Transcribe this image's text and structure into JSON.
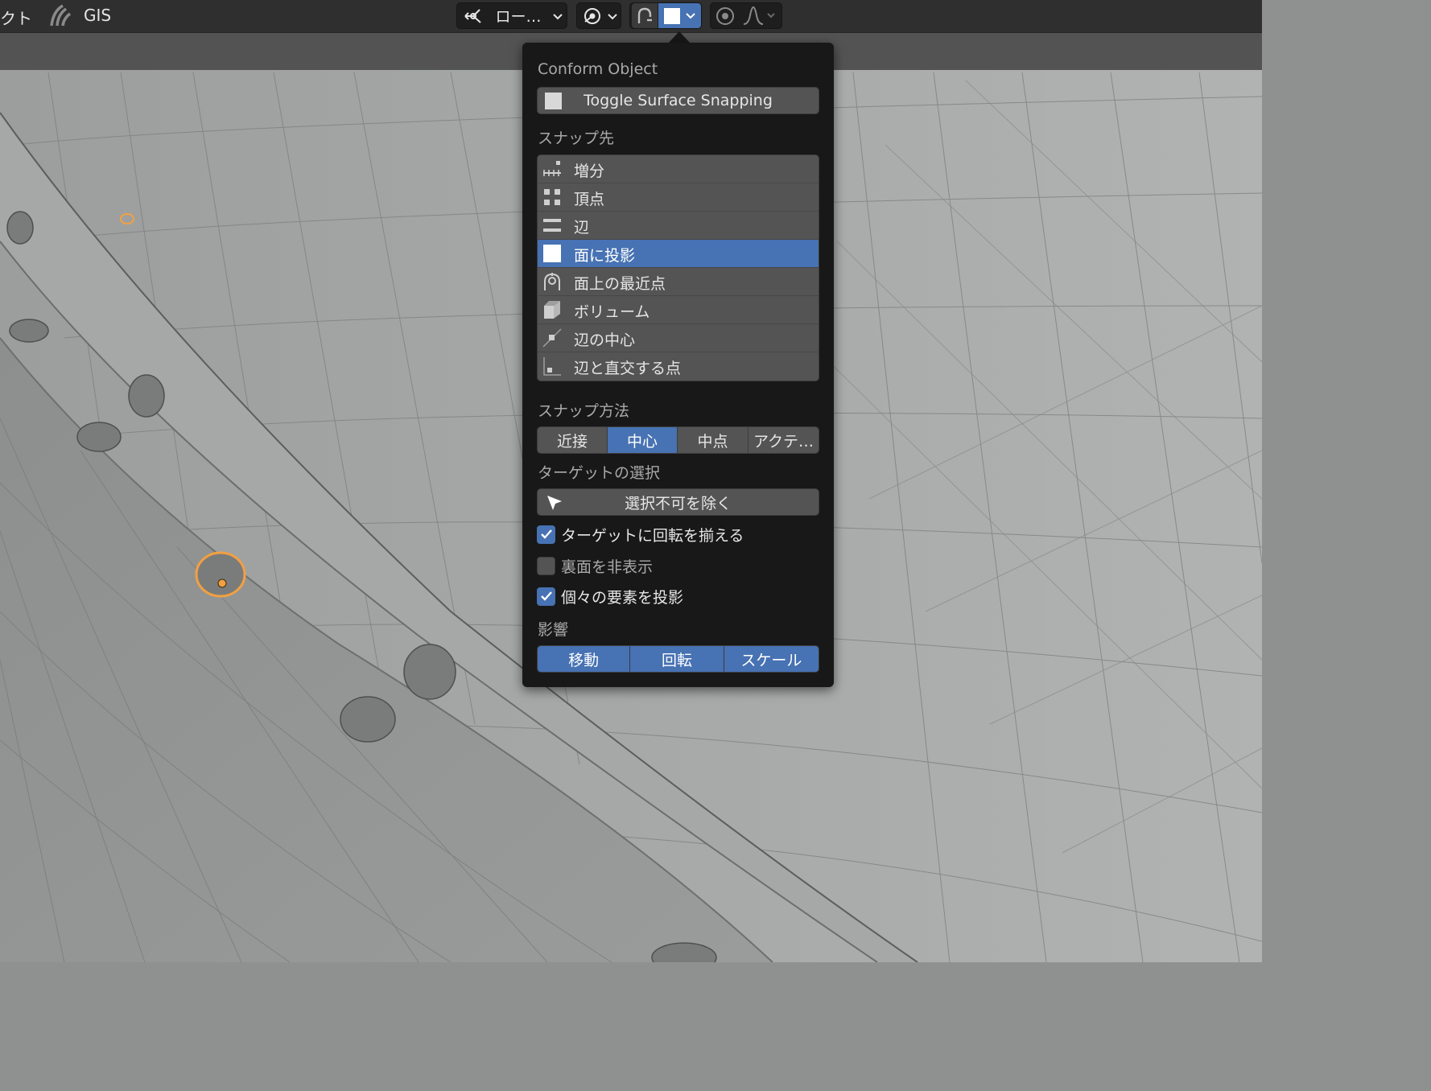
{
  "topbar": {
    "menu_fragment": "クト",
    "gis_label": "GIS",
    "pivot_label": "ロー…"
  },
  "popover": {
    "conform_header": "Conform Object",
    "toggle_surface_label": "Toggle Surface Snapping",
    "snap_to_header": "スナップ先",
    "snap_items": [
      {
        "label": "増分",
        "icon": "increment-icon"
      },
      {
        "label": "頂点",
        "icon": "vertex-icon"
      },
      {
        "label": "辺",
        "icon": "edge-icon"
      },
      {
        "label": "面に投影",
        "icon": "face-project-icon",
        "active": true
      },
      {
        "label": "面上の最近点",
        "icon": "face-nearest-icon"
      },
      {
        "label": "ボリューム",
        "icon": "volume-icon"
      },
      {
        "label": "辺の中心",
        "icon": "edge-center-icon"
      },
      {
        "label": "辺と直交する点",
        "icon": "edge-perpendicular-icon"
      }
    ],
    "snap_with_header": "スナップ方法",
    "snap_with_options": [
      {
        "label": "近接",
        "on": false
      },
      {
        "label": "中心",
        "on": true
      },
      {
        "label": "中点",
        "on": false
      },
      {
        "label": "アクテ…",
        "on": false
      }
    ],
    "target_selection_header": "ターゲットの選択",
    "exclude_nonselectable_label": "選択不可を除く",
    "checks": [
      {
        "label": "ターゲットに回転を揃える",
        "checked": true
      },
      {
        "label": "裏面を非表示",
        "checked": false
      },
      {
        "label": "個々の要素を投影",
        "checked": true
      }
    ],
    "affect_header": "影響",
    "affect_options": [
      {
        "label": "移動",
        "on": true
      },
      {
        "label": "回転",
        "on": true
      },
      {
        "label": "スケール",
        "on": true
      }
    ]
  },
  "colors": {
    "accent": "#4772b3",
    "panel_bg": "#181818",
    "widget_bg": "#545454",
    "selection_outline": "#f2a041"
  }
}
